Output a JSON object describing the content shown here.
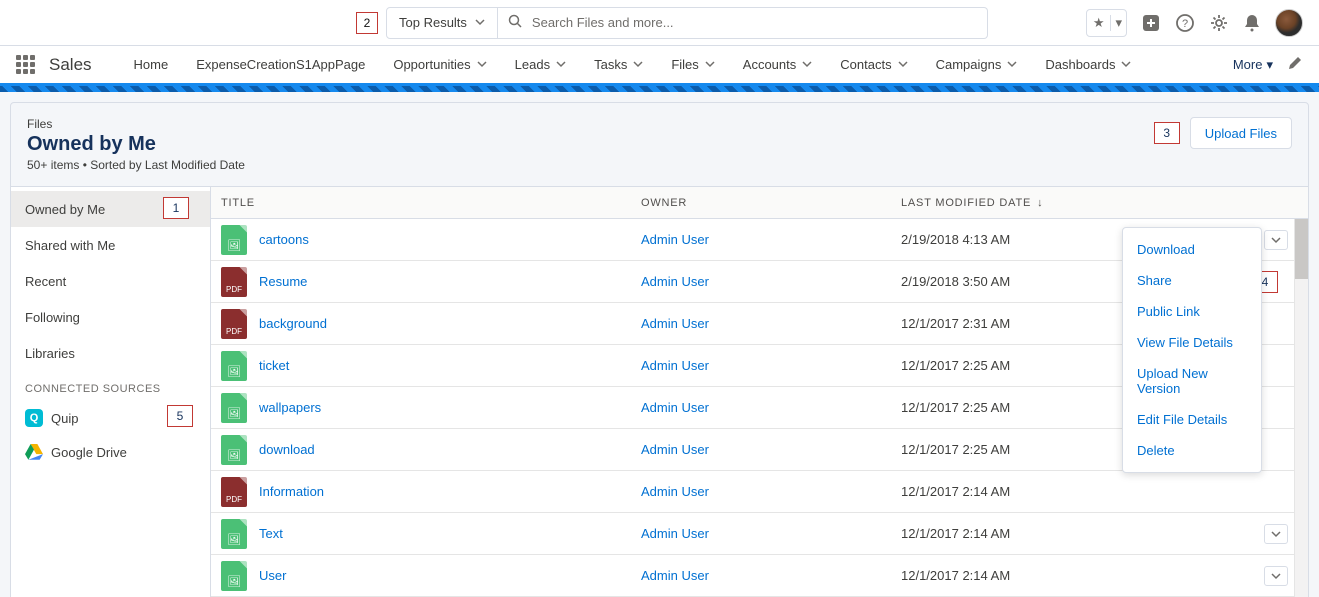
{
  "annotations": {
    "a1": "1",
    "a2": "2",
    "a3": "3",
    "a4": "4",
    "a5": "5"
  },
  "top": {
    "results_label": "Top Results",
    "search_placeholder": "Search Files and more..."
  },
  "nav": {
    "app_name": "Sales",
    "items": [
      {
        "label": "Home",
        "dropdown": false
      },
      {
        "label": "ExpenseCreationS1AppPage",
        "dropdown": false
      },
      {
        "label": "Opportunities",
        "dropdown": true
      },
      {
        "label": "Leads",
        "dropdown": true
      },
      {
        "label": "Tasks",
        "dropdown": true
      },
      {
        "label": "Files",
        "dropdown": true,
        "active": true
      },
      {
        "label": "Accounts",
        "dropdown": true
      },
      {
        "label": "Contacts",
        "dropdown": true
      },
      {
        "label": "Campaigns",
        "dropdown": true
      },
      {
        "label": "Dashboards",
        "dropdown": true
      }
    ],
    "more_label": "More"
  },
  "header": {
    "crumb": "Files",
    "title": "Owned by Me",
    "subtitle": "50+ items • Sorted by Last Modified Date",
    "upload_label": "Upload Files"
  },
  "sidebar": {
    "items": [
      {
        "label": "Owned by Me",
        "active": true
      },
      {
        "label": "Shared with Me"
      },
      {
        "label": "Recent"
      },
      {
        "label": "Following"
      },
      {
        "label": "Libraries"
      }
    ],
    "connected_heading": "CONNECTED SOURCES",
    "connected": [
      {
        "label": "Quip",
        "icon": "quip"
      },
      {
        "label": "Google Drive",
        "icon": "gdrive"
      }
    ]
  },
  "table": {
    "columns": {
      "title": "TITLE",
      "owner": "OWNER",
      "date": "LAST MODIFIED DATE"
    },
    "rows": [
      {
        "icon": "img",
        "title": "cartoons",
        "owner": "Admin User",
        "date": "2/19/2018 4:13 AM"
      },
      {
        "icon": "pdf",
        "title": "Resume",
        "owner": "Admin User",
        "date": "2/19/2018 3:50 AM"
      },
      {
        "icon": "pdf",
        "title": "background",
        "owner": "Admin User",
        "date": "12/1/2017 2:31 AM"
      },
      {
        "icon": "img",
        "title": "ticket",
        "owner": "Admin User",
        "date": "12/1/2017 2:25 AM"
      },
      {
        "icon": "img",
        "title": "wallpapers",
        "owner": "Admin User",
        "date": "12/1/2017 2:25 AM"
      },
      {
        "icon": "img",
        "title": "download",
        "owner": "Admin User",
        "date": "12/1/2017 2:25 AM"
      },
      {
        "icon": "pdf",
        "title": "Information",
        "owner": "Admin User",
        "date": "12/1/2017 2:14 AM"
      },
      {
        "icon": "img",
        "title": "Text",
        "owner": "Admin User",
        "date": "12/1/2017 2:14 AM"
      },
      {
        "icon": "img",
        "title": "User",
        "owner": "Admin User",
        "date": "12/1/2017 2:14 AM"
      }
    ]
  },
  "dropdown": {
    "items": [
      "Download",
      "Share",
      "Public Link",
      "View File Details",
      "Upload New Version",
      "Edit File Details",
      "Delete"
    ]
  }
}
